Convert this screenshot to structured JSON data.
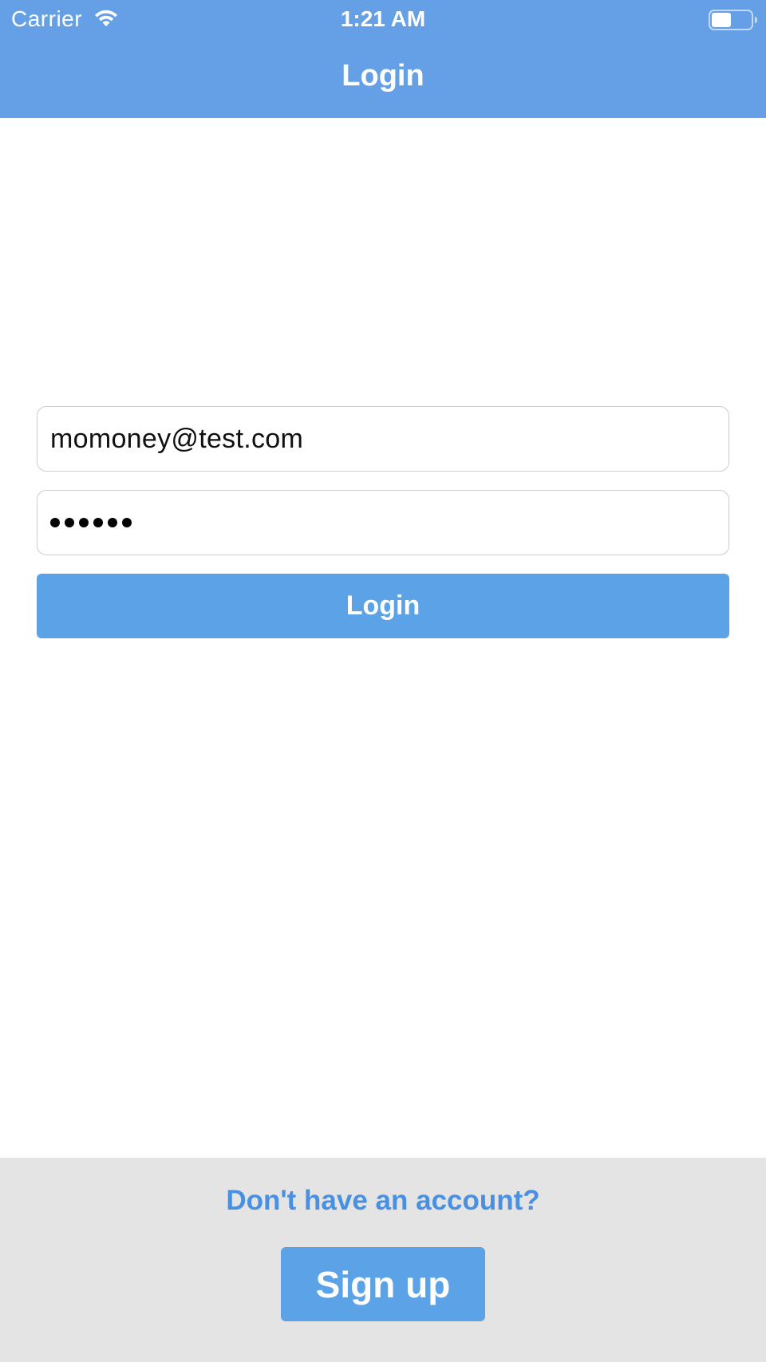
{
  "status_bar": {
    "carrier": "Carrier",
    "time": "1:21 AM",
    "wifi_icon": "wifi-icon",
    "battery_icon": "battery-icon",
    "battery_level": 0.5
  },
  "header": {
    "title": "Login",
    "background_color": "#65a0e6"
  },
  "form": {
    "email_value": "momoney@test.com",
    "password_length": 6,
    "login_label": "Login",
    "accent_color": "#5ba3e6"
  },
  "footer": {
    "prompt": "Don't have an account?",
    "signup_label": "Sign up",
    "prompt_color": "#4a90e2"
  }
}
